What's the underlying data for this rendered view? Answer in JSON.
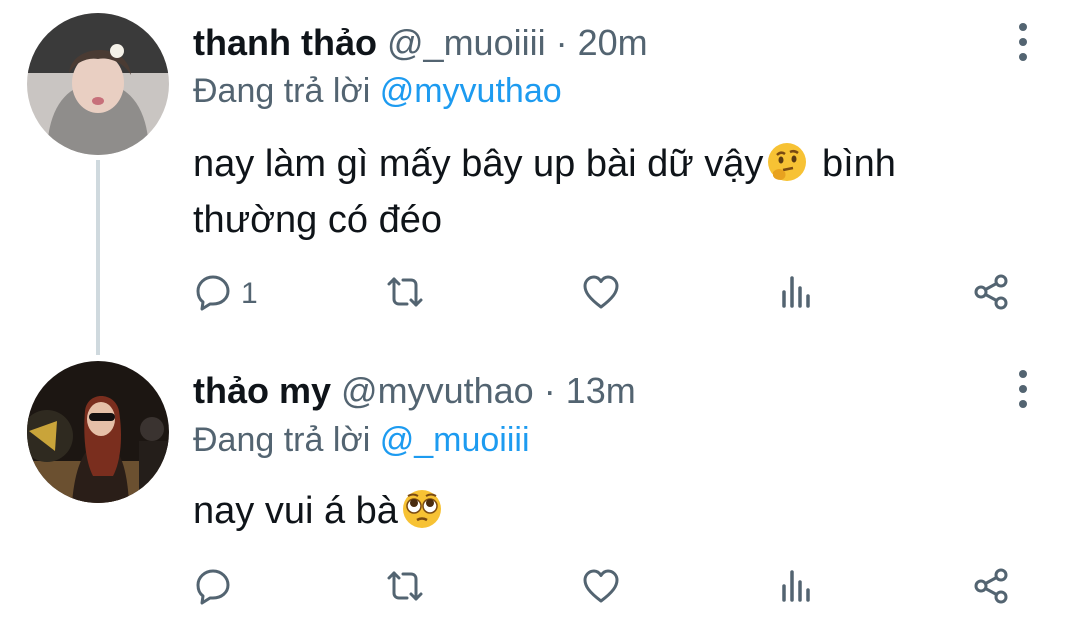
{
  "tweets": [
    {
      "name": "thanh thảo",
      "handle": "@_muoiiii",
      "separator": "·",
      "time": "20m",
      "reply_prefix": "Đang trả lời",
      "reply_to": "@myvuthao",
      "text_before": "nay làm gì mấy bây up bài dữ vậy",
      "emoji": "thinking-face-emoji",
      "text_after": " bình thường có đéo",
      "reply_count": "1"
    },
    {
      "name": "thảo my",
      "handle": "@myvuthao",
      "separator": "·",
      "time": "13m",
      "reply_prefix": "Đang trả lời",
      "reply_to": "@_muoiiii",
      "text_before": "nay vui á bà",
      "emoji": "pleading-eyes-emoji",
      "text_after": "",
      "reply_count": ""
    }
  ],
  "colors": {
    "text": "#0f1419",
    "secondary": "#536471",
    "accent": "#1d9bf0",
    "thread_line": "#cfd9de"
  },
  "icons": [
    "reply-icon",
    "retweet-icon",
    "like-icon",
    "views-icon",
    "share-icon",
    "more-icon"
  ]
}
